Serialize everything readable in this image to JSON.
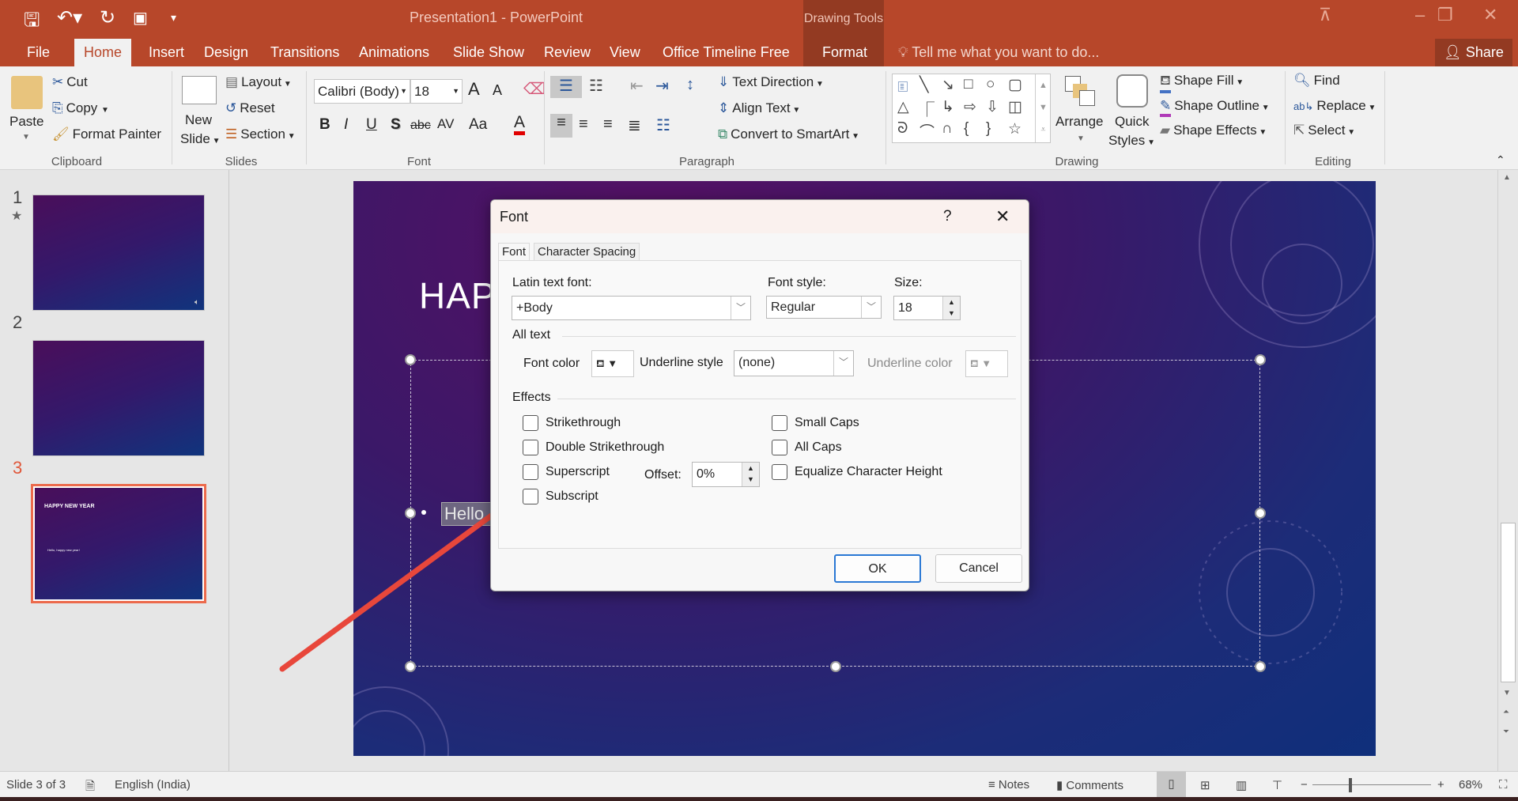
{
  "app": {
    "title": "Presentation1 - PowerPoint",
    "context_group": "Drawing Tools"
  },
  "tabs": [
    {
      "label": "File"
    },
    {
      "label": "Home"
    },
    {
      "label": "Insert"
    },
    {
      "label": "Design"
    },
    {
      "label": "Transitions"
    },
    {
      "label": "Animations"
    },
    {
      "label": "Slide Show"
    },
    {
      "label": "Review"
    },
    {
      "label": "View"
    },
    {
      "label": "Office Timeline Free"
    },
    {
      "label": "Format"
    }
  ],
  "tell_me": "Tell me what you want to do...",
  "share": "Share",
  "ribbon": {
    "clipboard": {
      "label": "Clipboard",
      "paste": "Paste",
      "cut": "Cut",
      "copy": "Copy",
      "format_painter": "Format Painter"
    },
    "slides": {
      "label": "Slides",
      "new": "New",
      "slide": "Slide",
      "layout": "Layout",
      "reset": "Reset",
      "section": "Section"
    },
    "font": {
      "label": "Font",
      "font_name": "Calibri (Body)",
      "font_size": "18",
      "bold": "B",
      "italic": "I",
      "underline": "U",
      "shadow": "S",
      "strike": "abc",
      "spacing": "AV",
      "case": "Aa",
      "color": "A",
      "grow": "A",
      "shrink": "A"
    },
    "paragraph": {
      "label": "Paragraph",
      "text_direction": "Text Direction",
      "align_text": "Align Text",
      "smartart": "Convert to SmartArt"
    },
    "drawing": {
      "label": "Drawing",
      "arrange": "Arrange",
      "quick": "Quick",
      "styles": "Styles",
      "shape_fill": "Shape Fill",
      "shape_outline": "Shape Outline",
      "shape_effects": "Shape Effects",
      "fill_color": "#4472c4",
      "outline_color": "#b03ab8"
    },
    "editing": {
      "label": "Editing",
      "find": "Find",
      "replace": "Replace",
      "select": "Select"
    }
  },
  "thumbnails": [
    {
      "num": "1"
    },
    {
      "num": "2"
    },
    {
      "num": "3",
      "title": "HAPPY NEW YEAR",
      "body": "Hello, happy new year!"
    }
  ],
  "slide": {
    "title": "HAPI",
    "selected_text": "Hello."
  },
  "dialog": {
    "title": "Font",
    "help": "?",
    "close": "✕",
    "tabs": [
      "Font",
      "Character Spacing"
    ],
    "latin_label": "Latin text font:",
    "latin_value": "+Body",
    "style_label": "Font style:",
    "style_value": "Regular",
    "size_label": "Size:",
    "size_value": "18",
    "all_text": "All text",
    "font_color": "Font color",
    "underline_style": "Underline style",
    "underline_value": "(none)",
    "underline_color": "Underline color",
    "effects": "Effects",
    "checks": [
      {
        "label": "Strikethrough",
        "checked": false
      },
      {
        "label": "Double Strikethrough",
        "checked": false
      },
      {
        "label": "Superscript",
        "checked": false
      },
      {
        "label": "Subscript",
        "checked": false
      },
      {
        "label": "Small Caps",
        "checked": false
      },
      {
        "label": "All Caps",
        "checked": false
      },
      {
        "label": "Equalize Character Height",
        "checked": false
      }
    ],
    "offset_label": "Offset:",
    "offset_value": "0%",
    "ok": "OK",
    "cancel": "Cancel"
  },
  "status": {
    "slide": "Slide 3 of 3",
    "language": "English (India)",
    "notes": "Notes",
    "comments": "Comments",
    "zoom": "68%",
    "zoom_percent": 68
  },
  "colors": {
    "accent": "#b7472a",
    "annotation_arrow": "#e8473b"
  }
}
